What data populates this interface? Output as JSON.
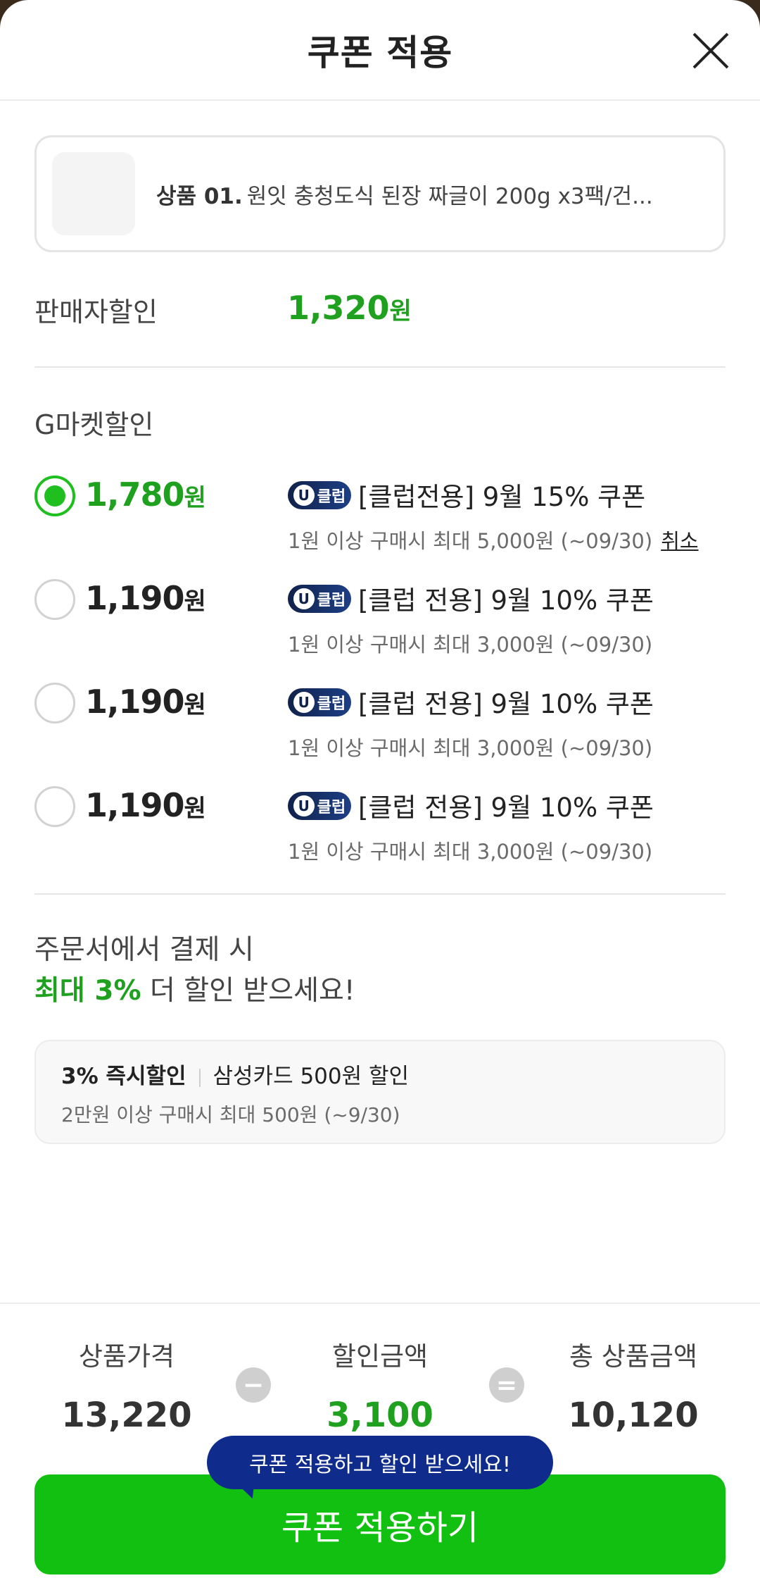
{
  "header": {
    "title": "쿠폰 적용",
    "close_icon": "close-icon"
  },
  "product": {
    "prefix": "상품 01.",
    "name": "원잇 충청도식 된장 짜글이 200g x3팩/건..."
  },
  "seller_discount": {
    "label": "판매자할인",
    "amount": "1,320",
    "unit": "원"
  },
  "gmarket": {
    "label": "G마켓할인",
    "coupons": [
      {
        "amount": "1,780",
        "unit": "원",
        "selected": true,
        "badge": "클럽",
        "name": "[클럽전용] 9월 15% 쿠폰",
        "desc": "1원 이상 구매시 최대 5,000원 (~09/30)",
        "cancel": "취소"
      },
      {
        "amount": "1,190",
        "unit": "원",
        "selected": false,
        "badge": "클럽",
        "name": "[클럽 전용] 9월 10% 쿠폰",
        "desc": "1원 이상 구매시 최대 3,000원 (~09/30)"
      },
      {
        "amount": "1,190",
        "unit": "원",
        "selected": false,
        "badge": "클럽",
        "name": "[클럽 전용] 9월 10% 쿠폰",
        "desc": "1원 이상 구매시 최대 3,000원 (~09/30)"
      },
      {
        "amount": "1,190",
        "unit": "원",
        "selected": false,
        "badge": "클럽",
        "name": "[클럽 전용] 9월 10% 쿠폰",
        "desc": "1원 이상 구매시 최대 3,000원 (~09/30)"
      }
    ],
    "badge_letter": "U"
  },
  "promo": {
    "line1": "주문서에서 결제 시",
    "highlight": "최대 3%",
    "line2_rest": " 더 할인 받으세요!",
    "card": {
      "title": "3% 즉시할인",
      "subtitle": "삼성카드 500원 할인",
      "desc": "2만원 이상 구매시 최대 500원 (~9/30)"
    }
  },
  "summary": {
    "price_label": "상품가격",
    "price": "13,220",
    "minus": "−",
    "discount_label": "할인금액",
    "discount": "3,100",
    "equals": "=",
    "total_label": "총 상품금액",
    "total": "10,120"
  },
  "tooltip": "쿠폰 적용하고 할인 받으세요!",
  "apply_button": "쿠폰 적용하기",
  "colors": {
    "green": "#1fa11f",
    "button_green": "#11c011",
    "tooltip_blue": "#0f2c8c"
  }
}
